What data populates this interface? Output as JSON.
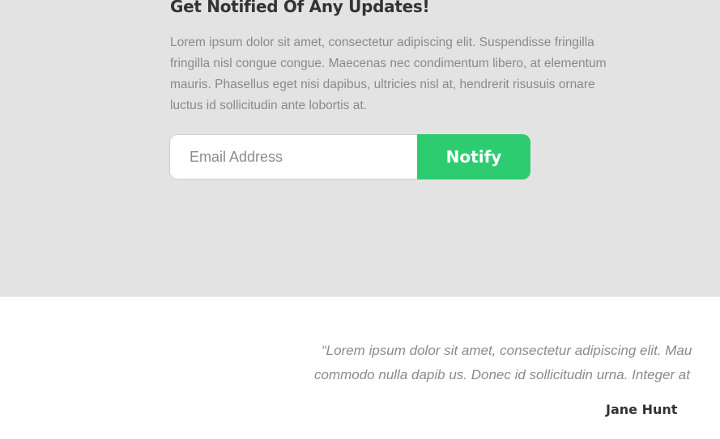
{
  "notify": {
    "title": "Get Notified Of Any Updates!",
    "description": "Lorem ipsum dolor sit amet, consectetur adipiscing elit. Suspendisse fringilla fringilla nisl congue congue. Maecenas nec condimentum libero, at elementum mauris. Phasellus eget nisi dapibus, ultricies nisl at, hendrerit risusuis ornare luctus id sollicitudin ante lobortis at.",
    "email_placeholder": "Email Address",
    "email_value": "",
    "button_label": "Notify",
    "accent_color": "#2ecc71",
    "background_color": "#e3e3e3"
  },
  "testimonial": {
    "quote_line_1": "“Lorem ipsum dolor sit amet, consectetur adipiscing elit. Mau",
    "quote_line_2": "commodo nulla dapib us. Donec id sollicitudin urna. Integer at",
    "author": "Jane Hunt"
  }
}
